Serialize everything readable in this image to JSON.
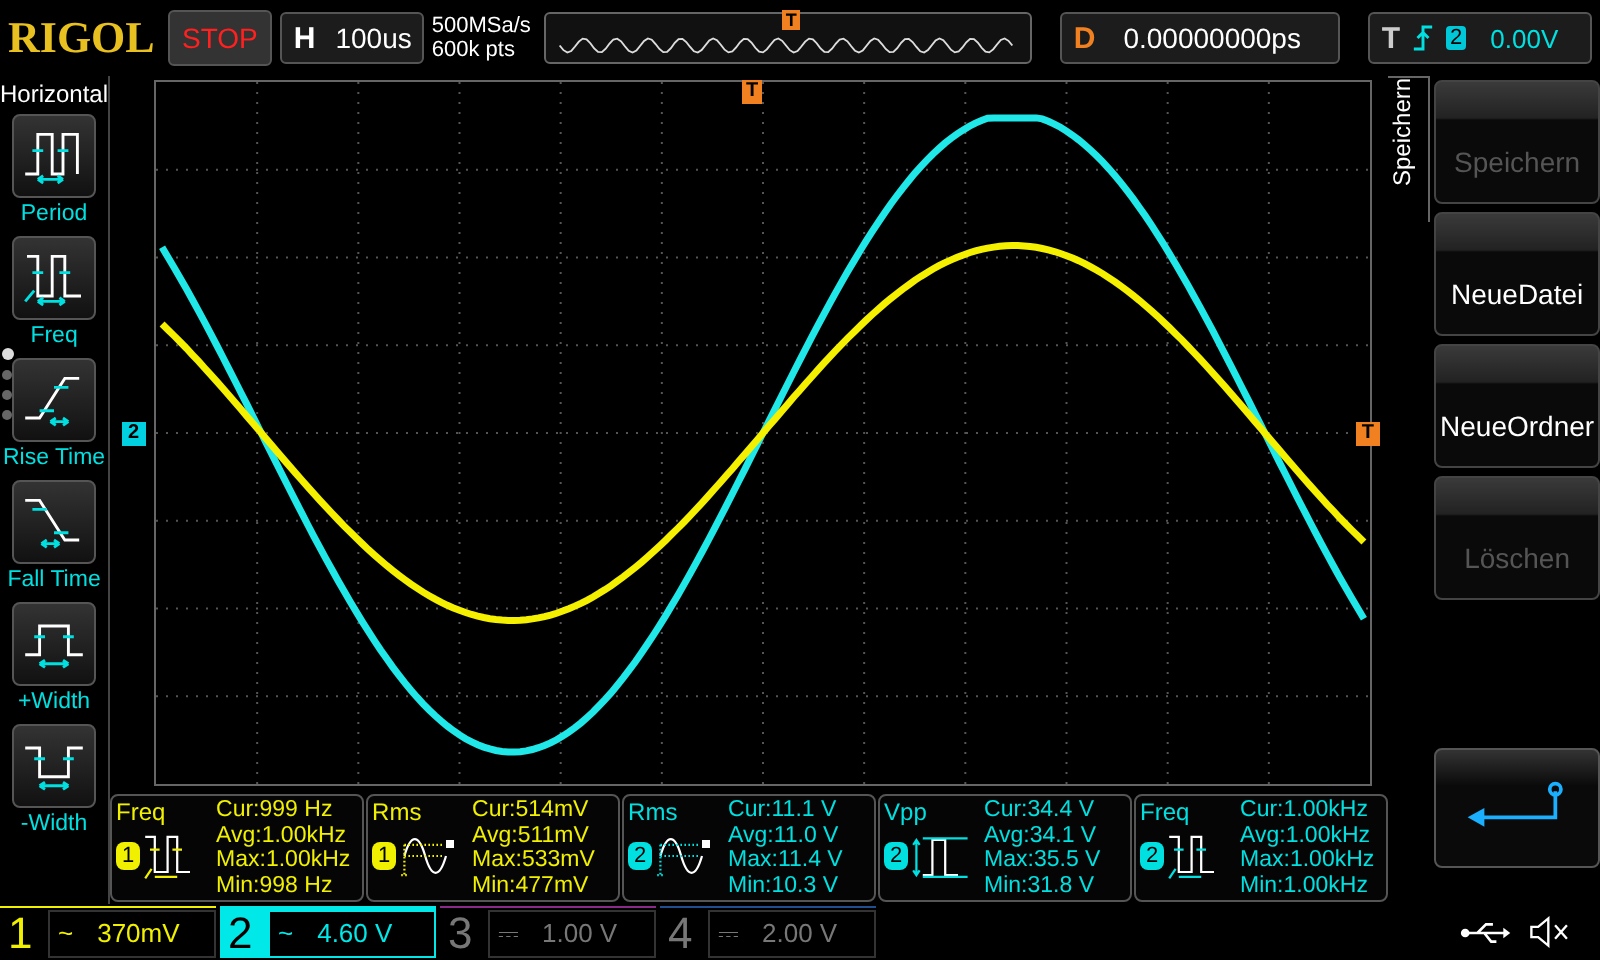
{
  "brand": "RIGOL",
  "run_state": "STOP",
  "horizontal": {
    "label": "H",
    "timebase": "100us"
  },
  "acquisition": {
    "sample_rate": "500MSa/s",
    "memory_depth": "600k pts"
  },
  "overview": {
    "trigger_marker": "T"
  },
  "delay": {
    "label": "D",
    "value": "0.00000000ps"
  },
  "trigger": {
    "label": "T",
    "source": "2",
    "level": "0.00V"
  },
  "left_menu": {
    "title": "Horizontal",
    "pages": [
      {
        "selected": true
      },
      {
        "selected": false
      },
      {
        "selected": false
      },
      {
        "selected": false
      }
    ],
    "items": [
      {
        "kind": "period",
        "label": "Period"
      },
      {
        "kind": "freq",
        "label": "Freq"
      },
      {
        "kind": "rise",
        "label": "Rise Time"
      },
      {
        "kind": "fall",
        "label": "Fall Time"
      },
      {
        "kind": "pwidth",
        "label": "+Width"
      },
      {
        "kind": "nwidth",
        "label": "-Width"
      }
    ]
  },
  "plot": {
    "trigger_position_marker": "T",
    "trigger_level_marker": "T",
    "channel_marker": "2"
  },
  "measurements": [
    {
      "kind": "freq",
      "name": "Freq",
      "channel": "1",
      "color": "#f0f000",
      "values": [
        "Cur:999 Hz",
        "Avg:1.00kHz",
        "Max:1.00kHz",
        "Min:998 Hz"
      ]
    },
    {
      "kind": "rms",
      "name": "Rms",
      "channel": "1",
      "color": "#f0f000",
      "values": [
        "Cur:514mV",
        "Avg:511mV",
        "Max:533mV",
        "Min:477mV"
      ]
    },
    {
      "kind": "rms",
      "name": "Rms",
      "channel": "2",
      "color": "#00e0e0",
      "values": [
        "Cur:11.1 V",
        "Avg:11.0 V",
        "Max:11.4 V",
        "Min:10.3 V"
      ]
    },
    {
      "kind": "vpp",
      "name": "Vpp",
      "channel": "2",
      "color": "#00e0e0",
      "values": [
        "Cur:34.4 V",
        "Avg:34.1 V",
        "Max:35.5 V",
        "Min:31.8 V"
      ]
    },
    {
      "kind": "freq",
      "name": "Freq",
      "channel": "2",
      "color": "#00e0e0",
      "values": [
        "Cur:1.00kHz",
        "Avg:1.00kHz",
        "Max:1.00kHz",
        "Min:1.00kHz"
      ]
    }
  ],
  "right_menu": {
    "title": "Speichern",
    "items": [
      {
        "label": "Speichern",
        "disabled": true
      },
      {
        "label": "NeueDatei",
        "disabled": false
      },
      {
        "label": "NeueOrdner",
        "disabled": false
      },
      {
        "label": "Löschen",
        "disabled": true
      }
    ]
  },
  "channels": [
    {
      "number": "1",
      "coupling": "~",
      "scale": "370mV",
      "selected": false,
      "enabled": true,
      "color": "#f0f000"
    },
    {
      "number": "2",
      "coupling": "~",
      "scale": "4.60 V",
      "selected": true,
      "enabled": true,
      "color": "#00e8e8"
    },
    {
      "number": "3",
      "coupling": "⎓",
      "scale": "1.00 V",
      "selected": false,
      "enabled": false,
      "color": "#8a2a8a"
    },
    {
      "number": "4",
      "coupling": "⎓",
      "scale": "2.00 V",
      "selected": false,
      "enabled": false,
      "color": "#1f4f8f"
    }
  ]
}
